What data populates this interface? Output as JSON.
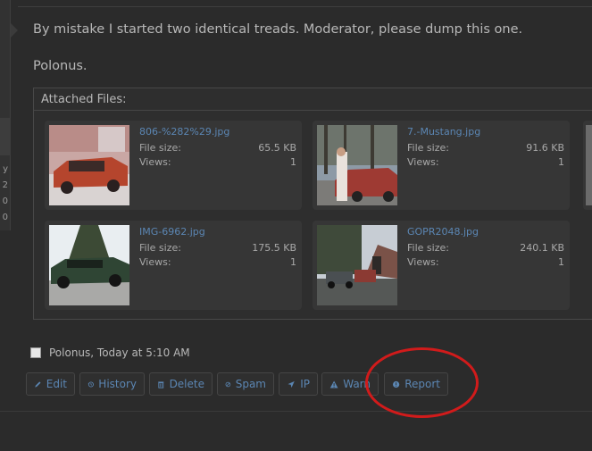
{
  "post": {
    "line1": "By mistake I started two identical treads. Moderator, please dump this one.",
    "line2": "Polonus."
  },
  "left_panel_chars": [
    "y",
    "2",
    "0",
    "0"
  ],
  "attachments": {
    "title": "Attached Files:",
    "size_label": "File size:",
    "views_label": "Views:",
    "files": [
      {
        "name": "806-%282%29.jpg",
        "size": "65.5 KB",
        "views": "1"
      },
      {
        "name": "7.-Mustang.jpg",
        "size": "91.6 KB",
        "views": "1"
      },
      {
        "name": "IMG-6962.jpg",
        "size": "175.5 KB",
        "views": "1"
      },
      {
        "name": "GOPR2048.jpg",
        "size": "240.1 KB",
        "views": "1"
      }
    ]
  },
  "signature": {
    "text": "Polonus, Today at 5:10 AM"
  },
  "actions": {
    "edit": "Edit",
    "history": "History",
    "delete": "Delete",
    "spam": "Spam",
    "ip": "IP",
    "warn": "Warn",
    "report": "Report"
  },
  "colors": {
    "background": "#2b2b2b",
    "link": "#5b86b3",
    "highlight_circle": "#d11b1b"
  }
}
